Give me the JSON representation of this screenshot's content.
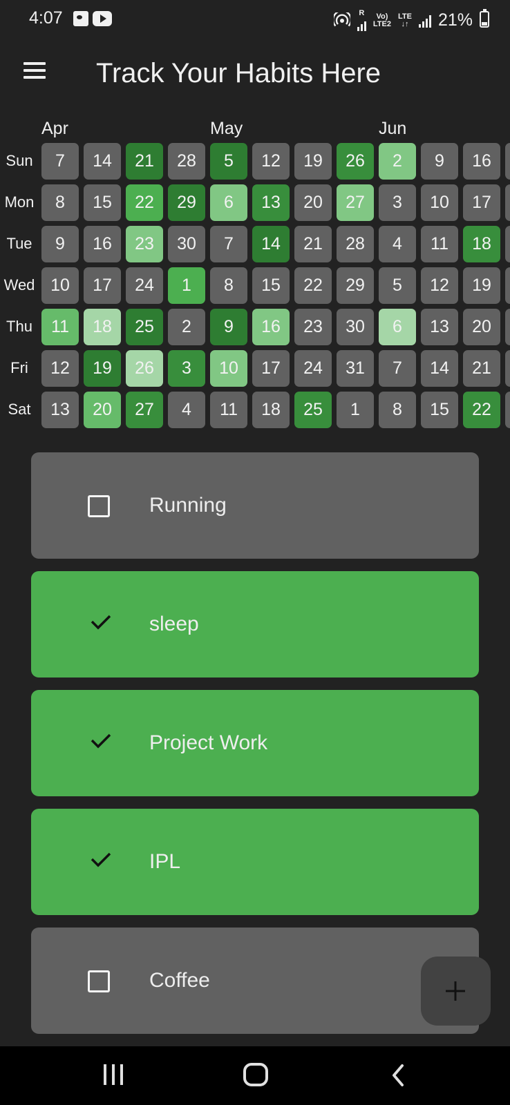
{
  "status_bar": {
    "time": "4:07",
    "left_icons": [
      "gallery-icon",
      "youtube-icon"
    ],
    "network_r": "R",
    "volte_top": "Vo)",
    "volte_bottom": "LTE2",
    "lte": "LTE",
    "battery": "21%"
  },
  "app_bar": {
    "title": "Track Your Habits Here"
  },
  "heatmap": {
    "months": [
      "Apr",
      "May",
      "Jun"
    ],
    "weekdays": [
      "Sun",
      "Mon",
      "Tue",
      "Wed",
      "Thu",
      "Fri",
      "Sat"
    ],
    "columns": [
      [
        {
          "day": "7",
          "level": 0
        },
        {
          "day": "8",
          "level": 0
        },
        {
          "day": "9",
          "level": 0
        },
        {
          "day": "10",
          "level": 0
        },
        {
          "day": "11",
          "level": 3
        },
        {
          "day": "12",
          "level": 0
        },
        {
          "day": "13",
          "level": 0
        }
      ],
      [
        {
          "day": "14",
          "level": 0
        },
        {
          "day": "15",
          "level": 0
        },
        {
          "day": "16",
          "level": 0
        },
        {
          "day": "17",
          "level": 0
        },
        {
          "day": "18",
          "level": 1
        },
        {
          "day": "19",
          "level": 6
        },
        {
          "day": "20",
          "level": 3
        }
      ],
      [
        {
          "day": "21",
          "level": 6
        },
        {
          "day": "22",
          "level": 4
        },
        {
          "day": "23",
          "level": 2
        },
        {
          "day": "24",
          "level": 0
        },
        {
          "day": "25",
          "level": 6
        },
        {
          "day": "26",
          "level": 1
        },
        {
          "day": "27",
          "level": 5
        }
      ],
      [
        {
          "day": "28",
          "level": 0
        },
        {
          "day": "29",
          "level": 6
        },
        {
          "day": "30",
          "level": 0
        },
        {
          "day": "1",
          "level": 4
        },
        {
          "day": "2",
          "level": 0
        },
        {
          "day": "3",
          "level": 5
        },
        {
          "day": "4",
          "level": 0
        }
      ],
      [
        {
          "day": "5",
          "level": 6
        },
        {
          "day": "6",
          "level": 2
        },
        {
          "day": "7",
          "level": 0
        },
        {
          "day": "8",
          "level": 0
        },
        {
          "day": "9",
          "level": 6
        },
        {
          "day": "10",
          "level": 2
        },
        {
          "day": "11",
          "level": 0
        }
      ],
      [
        {
          "day": "12",
          "level": 0
        },
        {
          "day": "13",
          "level": 5
        },
        {
          "day": "14",
          "level": 6
        },
        {
          "day": "15",
          "level": 0
        },
        {
          "day": "16",
          "level": 2
        },
        {
          "day": "17",
          "level": 0
        },
        {
          "day": "18",
          "level": 0
        }
      ],
      [
        {
          "day": "19",
          "level": 0
        },
        {
          "day": "20",
          "level": 0
        },
        {
          "day": "21",
          "level": 0
        },
        {
          "day": "22",
          "level": 0
        },
        {
          "day": "23",
          "level": 0
        },
        {
          "day": "24",
          "level": 0
        },
        {
          "day": "25",
          "level": 5
        }
      ],
      [
        {
          "day": "26",
          "level": 5
        },
        {
          "day": "27",
          "level": 2
        },
        {
          "day": "28",
          "level": 0
        },
        {
          "day": "29",
          "level": 0
        },
        {
          "day": "30",
          "level": 0
        },
        {
          "day": "31",
          "level": 0
        },
        {
          "day": "1",
          "level": 0
        }
      ],
      [
        {
          "day": "2",
          "level": 2
        },
        {
          "day": "3",
          "level": 0
        },
        {
          "day": "4",
          "level": 0
        },
        {
          "day": "5",
          "level": 0
        },
        {
          "day": "6",
          "level": 1
        },
        {
          "day": "7",
          "level": 0
        },
        {
          "day": "8",
          "level": 0
        }
      ],
      [
        {
          "day": "9",
          "level": 0
        },
        {
          "day": "10",
          "level": 0
        },
        {
          "day": "11",
          "level": 0
        },
        {
          "day": "12",
          "level": 0
        },
        {
          "day": "13",
          "level": 0
        },
        {
          "day": "14",
          "level": 0
        },
        {
          "day": "15",
          "level": 0
        }
      ],
      [
        {
          "day": "16",
          "level": 0
        },
        {
          "day": "17",
          "level": 0
        },
        {
          "day": "18",
          "level": 5
        },
        {
          "day": "19",
          "level": 0
        },
        {
          "day": "20",
          "level": 0
        },
        {
          "day": "21",
          "level": 0
        },
        {
          "day": "22",
          "level": 5
        }
      ],
      [
        {
          "day": "",
          "level": 0
        },
        {
          "day": "",
          "level": 0
        },
        {
          "day": "",
          "level": 0
        },
        {
          "day": "",
          "level": 0
        },
        {
          "day": "",
          "level": 0
        },
        {
          "day": "",
          "level": 0
        },
        {
          "day": "",
          "level": 0
        }
      ]
    ],
    "level_colors": [
      "#616161",
      "#a5d6a7",
      "#81c784",
      "#66bb6a",
      "#4caf50",
      "#388e3c",
      "#2e7d32"
    ]
  },
  "habits": [
    {
      "name": "Running",
      "done": false
    },
    {
      "name": "sleep",
      "done": true
    },
    {
      "name": "Project Work",
      "done": true
    },
    {
      "name": "IPL",
      "done": true
    },
    {
      "name": "Coffee",
      "done": false
    }
  ],
  "fab": {
    "icon": "plus-icon"
  },
  "nav_bar": {
    "icons": [
      "recent-apps-icon",
      "home-icon",
      "back-icon"
    ]
  }
}
